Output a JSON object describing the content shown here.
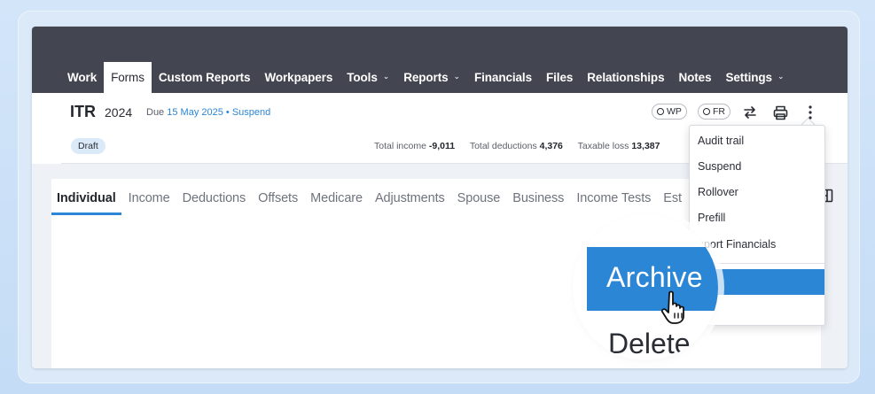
{
  "nav": {
    "items": [
      {
        "label": "Work"
      },
      {
        "label": "Forms"
      },
      {
        "label": "Custom Reports"
      },
      {
        "label": "Workpapers"
      },
      {
        "label": "Tools"
      },
      {
        "label": "Reports"
      },
      {
        "label": "Financials"
      },
      {
        "label": "Files"
      },
      {
        "label": "Relationships"
      },
      {
        "label": "Notes"
      },
      {
        "label": "Settings"
      }
    ]
  },
  "header": {
    "title": "ITR",
    "year": "2024",
    "due_prefix": "Due",
    "due_date": "15 May 2025",
    "separator": "•",
    "suspend_link": "Suspend",
    "wp_pill": "WP",
    "fr_pill": "FR"
  },
  "status": {
    "badge": "Draft",
    "total_income_label": "Total income",
    "total_income_value": "-9,011",
    "total_deductions_label": "Total deductions",
    "total_deductions_value": "4,376",
    "taxable_loss_label": "Taxable loss",
    "taxable_loss_value": "13,387"
  },
  "tabs": [
    {
      "label": "Individual"
    },
    {
      "label": "Income"
    },
    {
      "label": "Deductions"
    },
    {
      "label": "Offsets"
    },
    {
      "label": "Medicare"
    },
    {
      "label": "Adjustments"
    },
    {
      "label": "Spouse"
    },
    {
      "label": "Business"
    },
    {
      "label": "Income Tests"
    },
    {
      "label": "Est"
    }
  ],
  "menu": {
    "items": [
      {
        "label": "Audit trail"
      },
      {
        "label": "Suspend"
      },
      {
        "label": "Rollover"
      },
      {
        "label": "Prefill"
      },
      {
        "label": "nport Financials"
      },
      {
        "label": "ive"
      },
      {
        "label": "ete"
      }
    ]
  },
  "magnifier": {
    "archive": "Archive",
    "delete": "Delete"
  },
  "colors": {
    "topbar": "#434550",
    "accent": "#2c86d6"
  }
}
